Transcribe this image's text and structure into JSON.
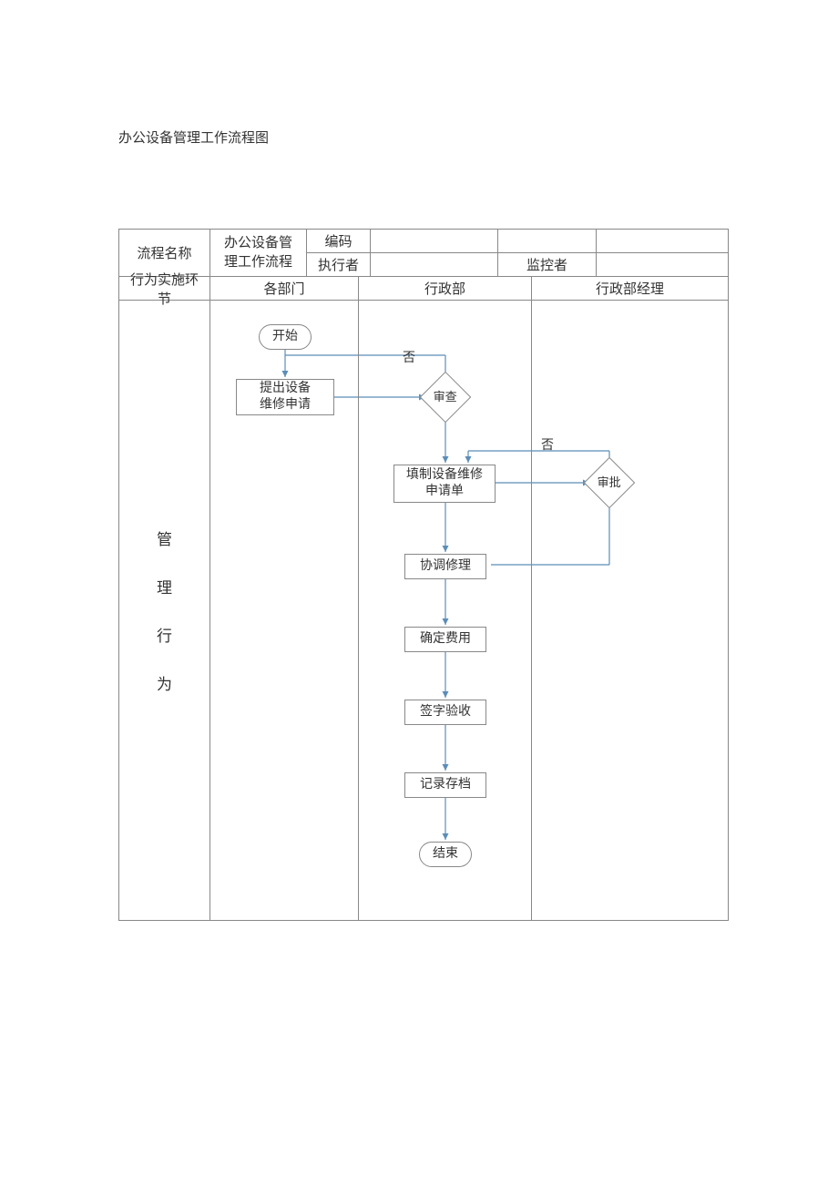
{
  "page_title": "办公设备管理工作流程图",
  "header": {
    "flow_name_label": "流程名称",
    "flow_name_value_1": "办公设备管",
    "flow_name_value_2": "理工作流程",
    "code_label": "编码",
    "code_value": "",
    "executor_label": "执行者",
    "executor_value": "",
    "monitor_label": "监控者",
    "monitor_value": ""
  },
  "swim_header": {
    "stage_label": "行为实施环节",
    "col2": "各部门",
    "col3": "行政部",
    "col4": "行政部经理"
  },
  "lane_label": {
    "l1": "管",
    "l2": "理",
    "l3": "行",
    "l4": "为"
  },
  "nodes": {
    "start": "开始",
    "request": "提出设备\n维修申请",
    "review": "审查",
    "fill_form": "填制设备维修\n申请单",
    "approve": "审批",
    "coordinate": "协调修理",
    "cost": "确定费用",
    "sign": "签字验收",
    "archive": "记录存档",
    "end": "结束"
  },
  "labels": {
    "no": "否"
  },
  "chart_data": {
    "type": "flowchart",
    "title": "办公设备管理工作流程图",
    "swimlanes": [
      "各部门",
      "行政部",
      "行政部经理"
    ],
    "nodes": [
      {
        "id": "start",
        "lane": "各部门",
        "type": "terminator",
        "label": "开始"
      },
      {
        "id": "request",
        "lane": "各部门",
        "type": "process",
        "label": "提出设备维修申请"
      },
      {
        "id": "review",
        "lane": "行政部",
        "type": "decision",
        "label": "审查"
      },
      {
        "id": "fill_form",
        "lane": "行政部",
        "type": "process",
        "label": "填制设备维修申请单"
      },
      {
        "id": "approve",
        "lane": "行政部经理",
        "type": "decision",
        "label": "审批"
      },
      {
        "id": "coordinate",
        "lane": "行政部",
        "type": "process",
        "label": "协调修理"
      },
      {
        "id": "cost",
        "lane": "行政部",
        "type": "process",
        "label": "确定费用"
      },
      {
        "id": "sign",
        "lane": "行政部",
        "type": "process",
        "label": "签字验收"
      },
      {
        "id": "archive",
        "lane": "行政部",
        "type": "process",
        "label": "记录存档"
      },
      {
        "id": "end",
        "lane": "行政部",
        "type": "terminator",
        "label": "结束"
      }
    ],
    "edges": [
      {
        "from": "start",
        "to": "request"
      },
      {
        "from": "request",
        "to": "review"
      },
      {
        "from": "review",
        "to": "request",
        "label": "否"
      },
      {
        "from": "review",
        "to": "fill_form"
      },
      {
        "from": "fill_form",
        "to": "approve"
      },
      {
        "from": "approve",
        "to": "fill_form",
        "label": "否"
      },
      {
        "from": "approve",
        "to": "coordinate"
      },
      {
        "from": "coordinate",
        "to": "cost"
      },
      {
        "from": "cost",
        "to": "sign"
      },
      {
        "from": "sign",
        "to": "archive"
      },
      {
        "from": "archive",
        "to": "end"
      }
    ]
  }
}
